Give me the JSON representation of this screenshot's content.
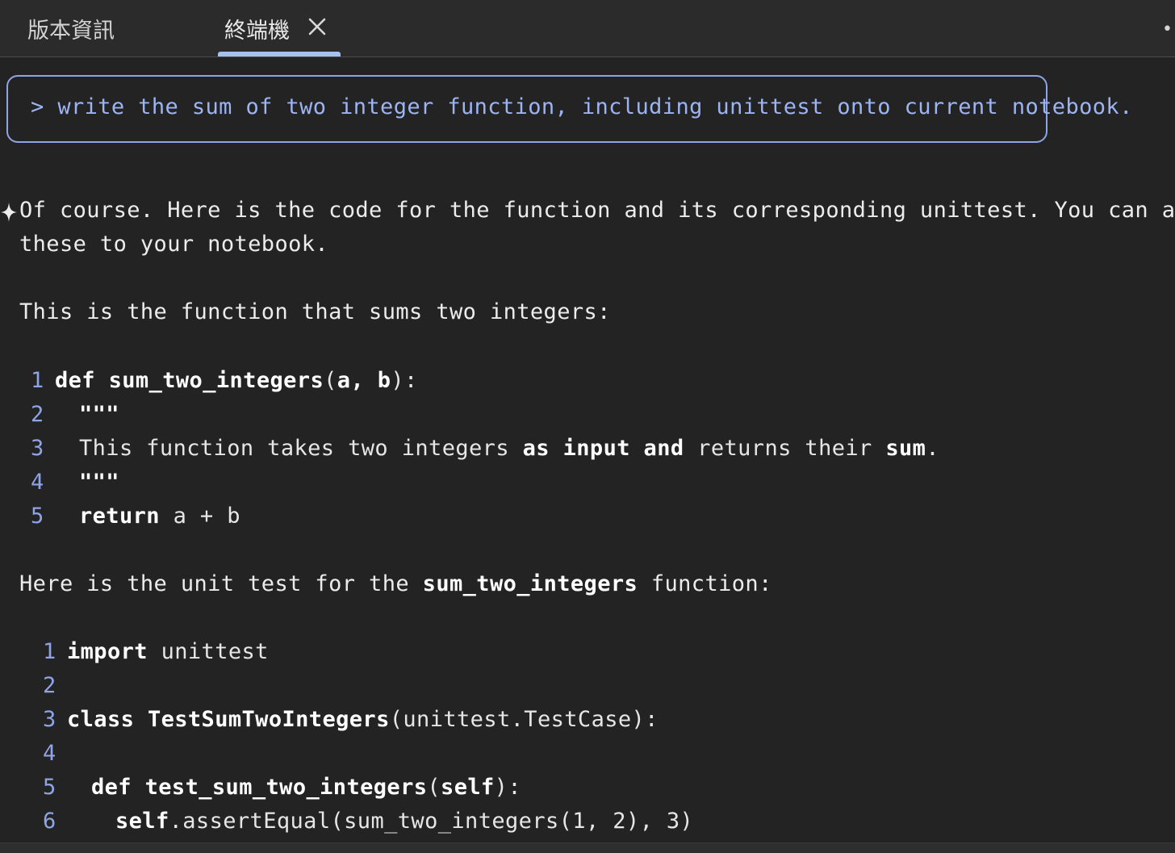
{
  "tabs": [
    {
      "label": "版本資訊"
    },
    {
      "label": "終端機"
    }
  ],
  "overflow": "••",
  "prompt": {
    "caret": ">",
    "text": "write the sum of two integer function, including unittest onto current notebook."
  },
  "response": {
    "intro_line1": "Of course. Here is the code for the function and its corresponding unittest. You can add",
    "intro_line2": "these to your notebook.",
    "function_intro": "This is the function that sums two integers:",
    "test_intro_before": "Here is the unit test for the ",
    "test_intro_name": "sum_two_integers",
    "test_intro_after": " function:"
  },
  "code_block_1": {
    "line_numbers": [
      "1",
      "2",
      "3",
      "4",
      "5"
    ],
    "def_kw": "def",
    "func_name": "sum_two_integers",
    "paren_open": "(",
    "arg_a": "a",
    "comma": ", ",
    "arg_b": "b",
    "paren_close": "):",
    "docstring_open": "\"\"\"",
    "doc_pre": "This function takes two integers ",
    "doc_as": "as",
    "doc_sp1": " ",
    "doc_input": "input",
    "doc_sp2": " ",
    "doc_and": "and",
    "doc_mid": " returns their ",
    "doc_sum": "sum",
    "doc_end": ".",
    "docstring_close": "\"\"\"",
    "return_kw": "return",
    "return_expr": " a + b"
  },
  "code_block_2": {
    "line_numbers": [
      "1",
      "2",
      "3",
      "4",
      "5",
      "6"
    ],
    "import_kw": "import",
    "import_mod": " unittest",
    "class_kw": "class",
    "class_name": "TestSumTwoIntegers",
    "class_base": "(unittest.TestCase):",
    "def_kw": "def",
    "method_name": "test_sum_two_integers",
    "method_paren_open": "(",
    "self_kw": "self",
    "method_paren_close": "):",
    "assert_self": "self",
    "assert_call": ".assertEqual(sum_two_integers(1, 2), 3)"
  }
}
